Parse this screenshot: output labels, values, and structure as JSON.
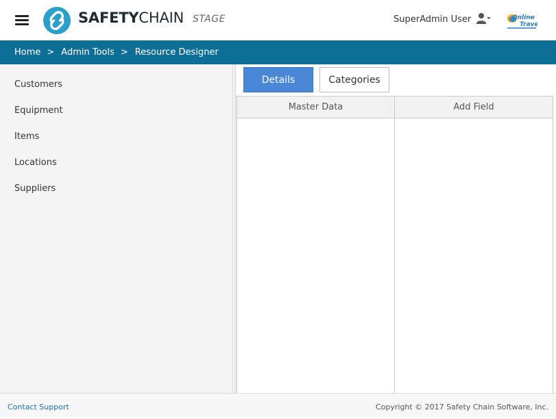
{
  "header": {
    "menu_icon": "hamburger-menu-icon",
    "logo_bold": "SAFETY",
    "logo_regular": "CHAIN",
    "environment": "STAGE",
    "user_name": "SuperAdmin User",
    "user_icon": "user-dropdown-icon",
    "brand_logo_line1": "Online",
    "brand_logo_line2": "Travel",
    "logo_color": "#2a9fc9"
  },
  "breadcrumb": {
    "bar_color": "#0e6f96",
    "items": [
      {
        "label": "Home"
      },
      {
        "label": "Admin Tools"
      },
      {
        "label": "Resource Designer"
      }
    ],
    "separator": ">"
  },
  "sidebar": {
    "items": [
      {
        "label": "Customers"
      },
      {
        "label": "Equipment"
      },
      {
        "label": "Items"
      },
      {
        "label": "Locations"
      },
      {
        "label": "Suppliers"
      }
    ]
  },
  "main": {
    "tabs": [
      {
        "label": "Details",
        "active": true,
        "color": "#4a87d6"
      },
      {
        "label": "Categories",
        "active": false
      }
    ],
    "columns": [
      {
        "header": "Master Data"
      },
      {
        "header": "Add Field"
      }
    ]
  },
  "footer": {
    "contact_label": "Contact Support",
    "copyright": "Copyright © 2017 Safety Chain Software, Inc."
  }
}
